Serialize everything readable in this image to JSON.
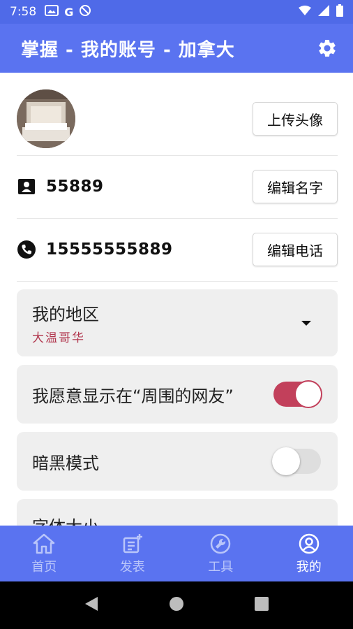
{
  "status_bar": {
    "time": "7:58",
    "left_icons": [
      "gallery-icon",
      "google-icon",
      "do-not-disturb-icon"
    ],
    "right_icons": [
      "wifi-icon",
      "signal-icon",
      "battery-icon"
    ],
    "google_glyph": "G"
  },
  "app_bar": {
    "title": "掌握 - 我的账号 - 加拿大",
    "settings_icon": "gear-icon"
  },
  "profile": {
    "upload_avatar_label": "上传头像",
    "name_value": "55889",
    "edit_name_label": "编辑名字",
    "phone_value": "15555555889",
    "edit_phone_label": "编辑电话"
  },
  "settings": {
    "region": {
      "label": "我的地区",
      "value": "大温哥华"
    },
    "visibility": {
      "label": "我愿意显示在“周围的网友”",
      "enabled": true
    },
    "dark_mode": {
      "label": "暗黑模式",
      "enabled": false
    },
    "font_size": {
      "label": "字体大小"
    }
  },
  "bottom_nav": {
    "items": [
      {
        "label": "首页",
        "icon": "home-icon",
        "active": false
      },
      {
        "label": "发表",
        "icon": "post-icon",
        "active": false
      },
      {
        "label": "工具",
        "icon": "wrench-icon",
        "active": false
      },
      {
        "label": "我的",
        "icon": "account-icon",
        "active": true
      }
    ]
  },
  "colors": {
    "primary": "#5a73f0",
    "accent": "#c2405b",
    "card": "#efefef"
  }
}
